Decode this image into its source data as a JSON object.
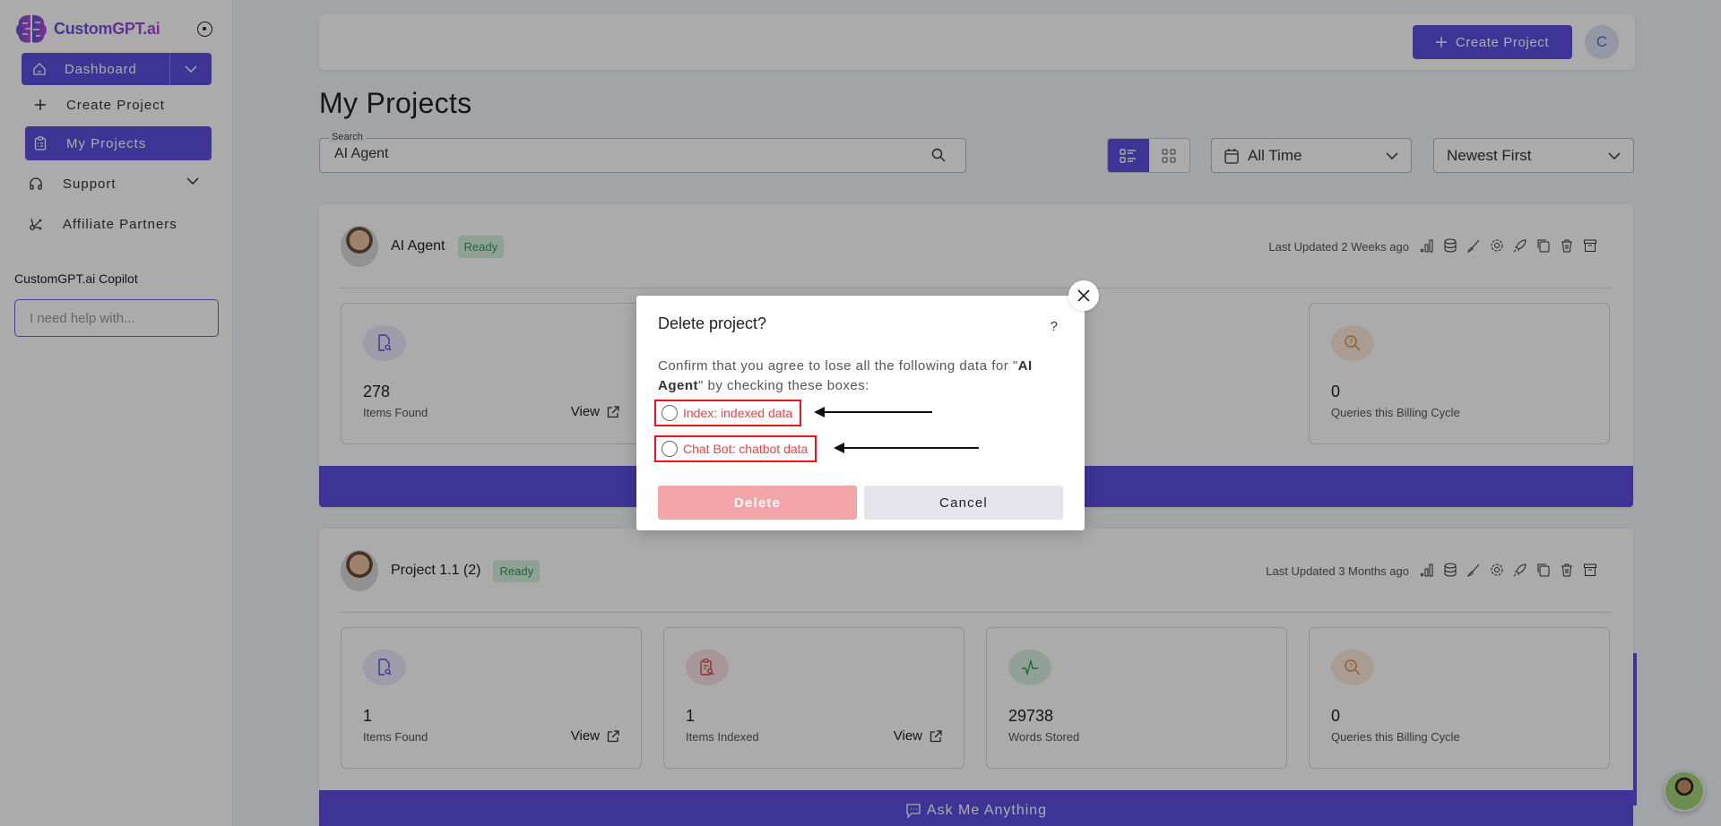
{
  "brand": {
    "name": "CustomGPT.ai"
  },
  "sidebar": {
    "dashboard_label": "Dashboard",
    "items": [
      {
        "label": "Create Project",
        "icon": "plus-icon"
      },
      {
        "label": "My Projects",
        "icon": "clipboard-icon",
        "active": true
      },
      {
        "label": "Support",
        "icon": "headphones-icon"
      },
      {
        "label": "Affiliate Partners",
        "icon": "affiliate-icon"
      }
    ],
    "copilot": {
      "label": "CustomGPT.ai Copilot",
      "placeholder": "I need help with..."
    }
  },
  "topbar": {
    "create_label": "Create Project",
    "avatar_initial": "C"
  },
  "page": {
    "title": "My Projects",
    "search": {
      "legend": "Search",
      "value": "AI Agent"
    },
    "date_filter": "All Time",
    "sort": "Newest First"
  },
  "projects": [
    {
      "name": "AI Agent",
      "status": "Ready",
      "updated": "Last Updated 2 Weeks ago",
      "stats": [
        {
          "value": "278",
          "label": "Items Found",
          "view": "View"
        },
        {
          "value": "0",
          "label": "Queries this Billing Cycle"
        }
      ]
    },
    {
      "name": "Project 1.1 (2)",
      "status": "Ready",
      "updated": "Last Updated 3 Months ago",
      "stats": [
        {
          "value": "1",
          "label": "Items Found",
          "view": "View"
        },
        {
          "value": "1",
          "label": "Items Indexed",
          "view": "View"
        },
        {
          "value": "29738",
          "label": "Words Stored"
        },
        {
          "value": "0",
          "label": "Queries this Billing Cycle"
        }
      ],
      "ask_label": "Ask Me Anything"
    }
  ],
  "modal": {
    "title": "Delete project?",
    "help": "?",
    "text_before": "Confirm that you agree to lose all the following data for \"",
    "project_name": "AI Agent",
    "text_after": "\" by checking these boxes:",
    "options": [
      {
        "label": "Index: indexed data",
        "checked": false
      },
      {
        "label": "Chat Bot: chatbot data",
        "checked": false
      }
    ],
    "delete_label": "Delete",
    "cancel_label": "Cancel"
  },
  "colors": {
    "accent": "#5b4ee0",
    "danger": "#e8444c",
    "ready": "#2f9a56"
  }
}
